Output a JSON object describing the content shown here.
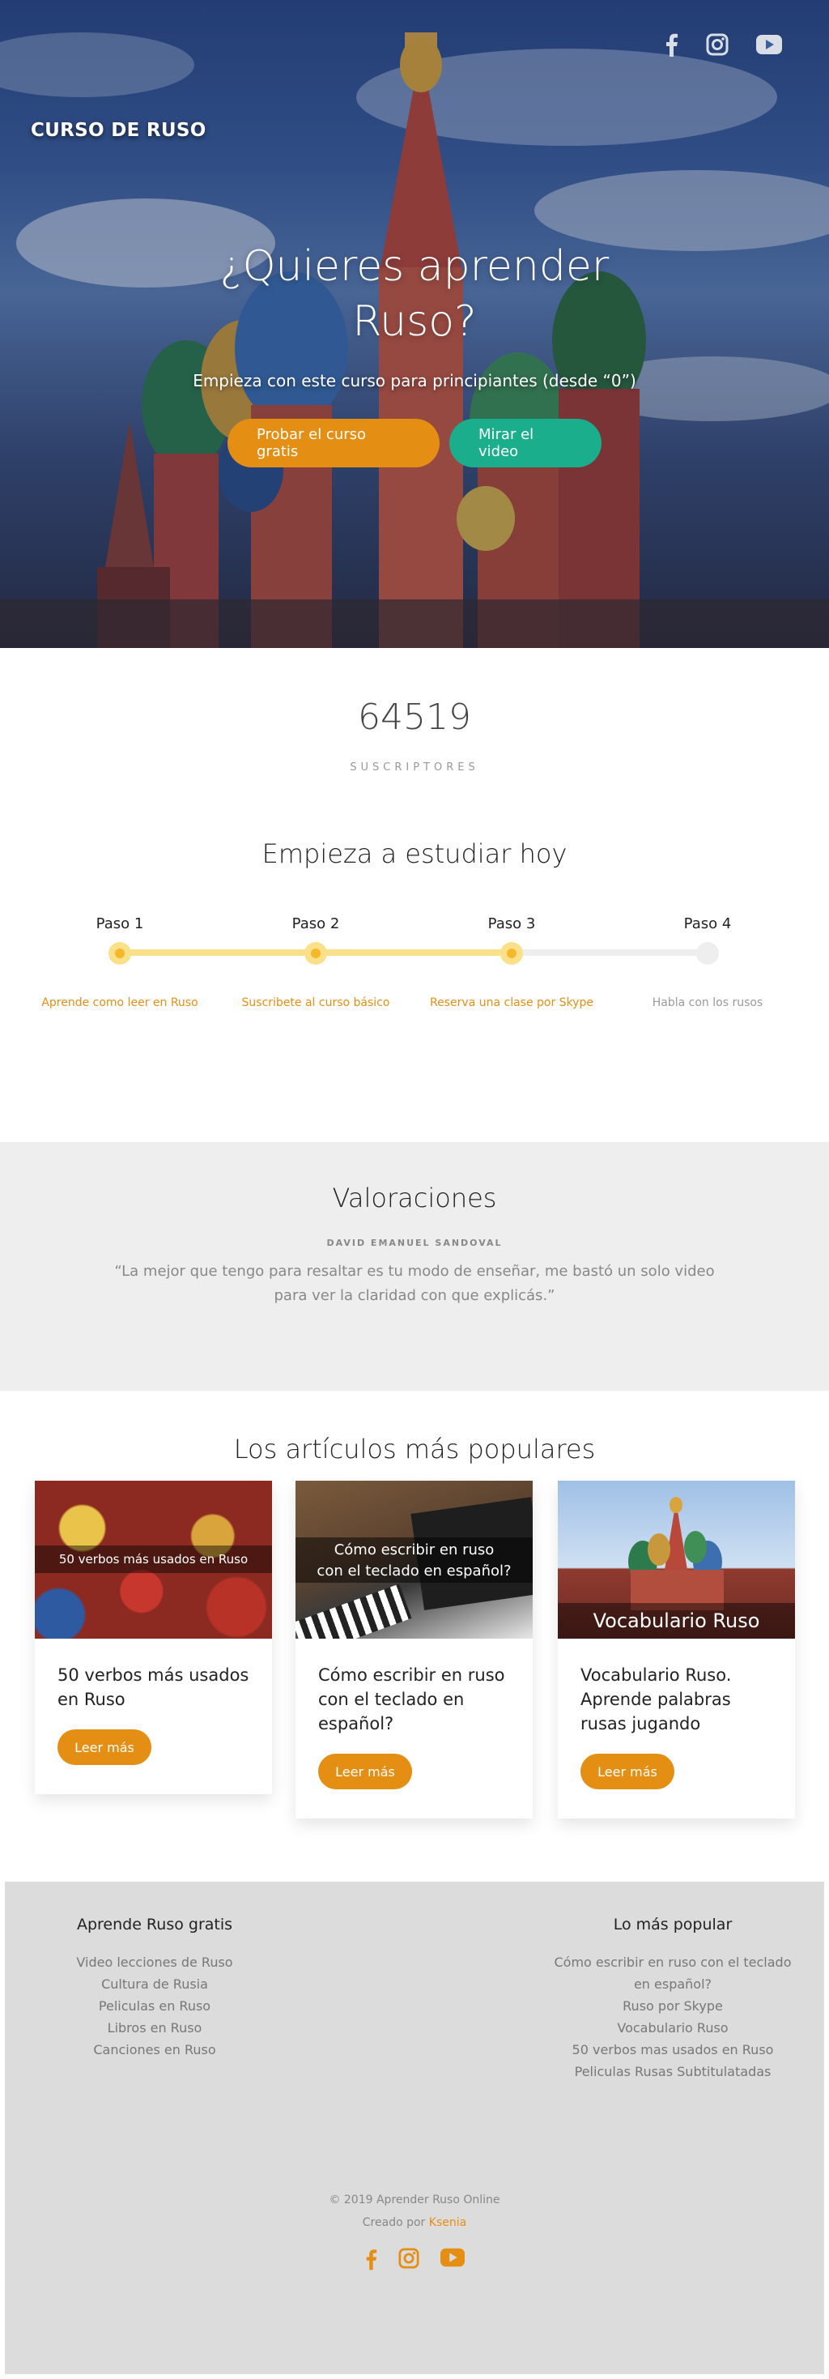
{
  "hero": {
    "brand": "CURSO DE RUSO",
    "title_line1": "¿Quieres aprender",
    "title_line2": "Ruso?",
    "subtitle": "Empieza con este curso para principiantes (desde “0”)",
    "cta_primary": "Probar el curso gratis",
    "cta_secondary": "Mirar el video",
    "social": [
      "facebook-icon",
      "instagram-icon",
      "youtube-icon"
    ]
  },
  "stats": {
    "number": "64519",
    "label": "SUSCRIPTORES"
  },
  "steps": {
    "title": "Empieza a estudiar hoy",
    "items": [
      {
        "label": "Paso 1",
        "desc": "Aprende como leer en Ruso",
        "done": true
      },
      {
        "label": "Paso 2",
        "desc": "Suscribete al curso básico",
        "done": true
      },
      {
        "label": "Paso 3",
        "desc": "Reserva una clase por Skype",
        "done": true
      },
      {
        "label": "Paso 4",
        "desc": "Habla con los rusos",
        "done": false
      }
    ],
    "colors": {
      "active": "#f5b82a",
      "active_text": "#e48f14",
      "inactive": "#eeeeee",
      "inactive_text": "#999999"
    }
  },
  "testimonial": {
    "title": "Valoraciones",
    "author": "DAVID EMANUEL SANDOVAL",
    "quote": "“La mejor que tengo para resaltar es tu modo de enseñar, me bastó un solo video para ver la claridad con que explicás.”"
  },
  "articles": {
    "title": "Los artículos más populares",
    "items": [
      {
        "image_caption": "50 verbos más usados en Ruso",
        "title": "50 verbos más usados en Ruso",
        "button": "Leer más"
      },
      {
        "image_caption_line1": "Cómo escribir en ruso",
        "image_caption_line2": "con el teclado en español?",
        "title": "Cómo escribir en ruso con el teclado en español?",
        "button": "Leer más"
      },
      {
        "image_caption": "Vocabulario Ruso",
        "title": "Vocabulario Ruso. Aprende palabras rusas jugando",
        "button": "Leer más"
      }
    ]
  },
  "footer": {
    "col1": {
      "title": "Aprende Ruso gratis",
      "links": [
        "Video lecciones de Ruso",
        "Cultura de Rusia",
        "Peliculas en Ruso",
        "Libros en Ruso",
        "Canciones en Ruso"
      ]
    },
    "col2": {
      "title": "Lo más popular",
      "links": [
        "Cómo escribir en ruso con el teclado",
        "en español?",
        "Ruso por Skype",
        "Vocabulario Ruso",
        "50 verbos mas usados en Ruso",
        "Peliculas Rusas Subtitulatadas"
      ]
    },
    "copyright": "© 2019 Aprender Ruso Online",
    "credit_prefix": "Creado por ",
    "credit_name": "Ksenia",
    "accent": "#e48f14"
  }
}
